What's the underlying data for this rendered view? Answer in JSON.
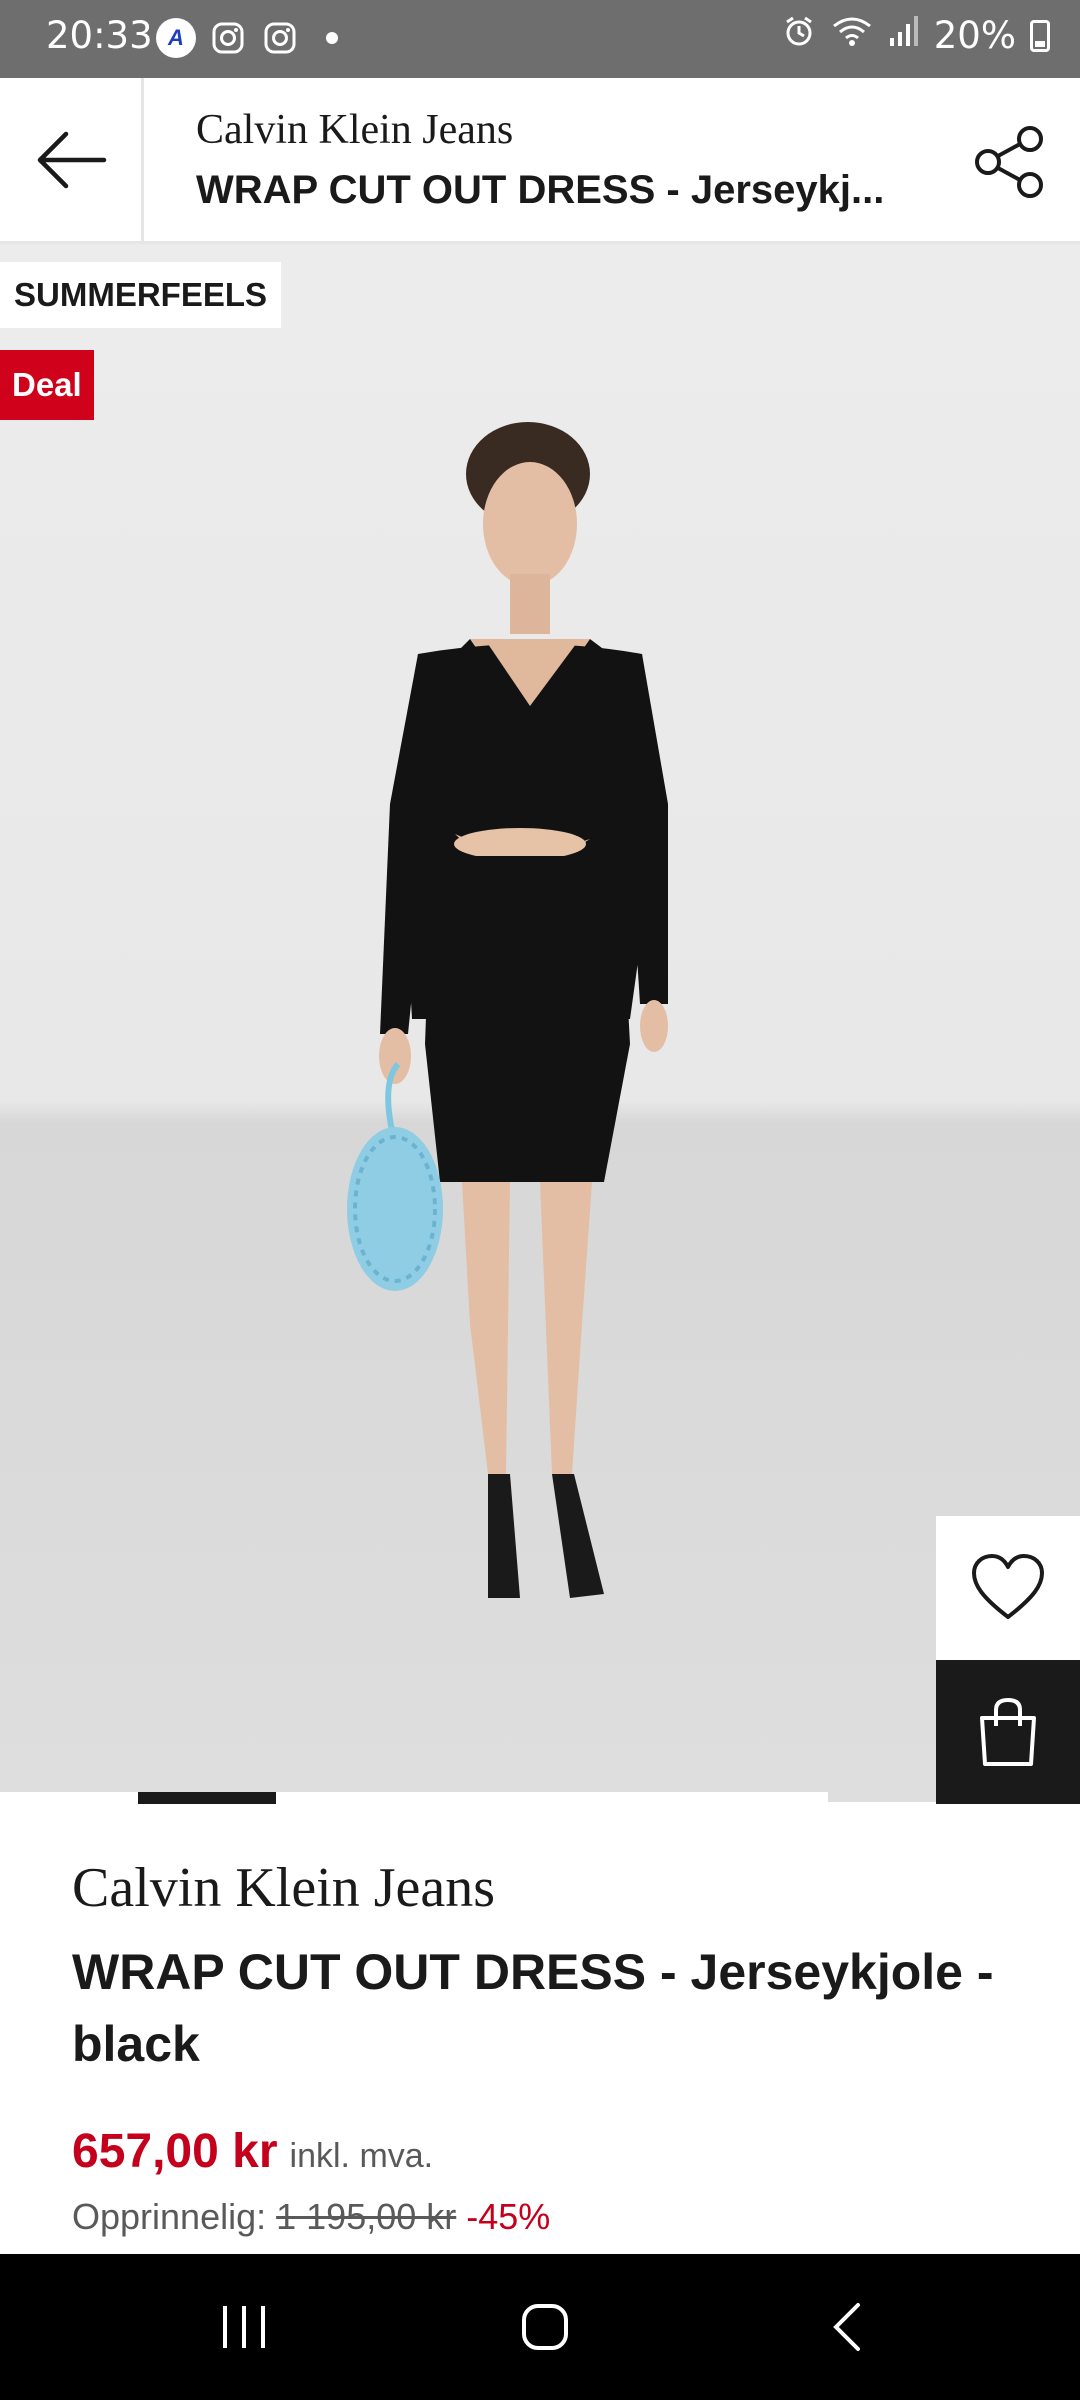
{
  "status_bar": {
    "time": "20:33",
    "battery": "20%",
    "notification_icons": [
      "app-a-icon",
      "instagram-icon",
      "instagram-icon"
    ]
  },
  "header": {
    "brand": "Calvin Klein Jeans",
    "title": "WRAP CUT OUT DRESS - Jerseykj..."
  },
  "badges": {
    "promo": "SUMMERFEELS",
    "deal": "Deal"
  },
  "carousel": {
    "active_index": 1
  },
  "product": {
    "brand": "Calvin Klein Jeans",
    "name": "WRAP CUT OUT DRESS - Jerseykjole - black",
    "price": "657,00 kr",
    "price_note": "inkl. mva.",
    "original_label": "Opprinnelig:",
    "original_price": "1 195,00 kr",
    "discount": "-45%"
  },
  "colors": {
    "price_red": "#c4001c",
    "deal_red": "#d0021b",
    "dark": "#1a1a1a"
  }
}
